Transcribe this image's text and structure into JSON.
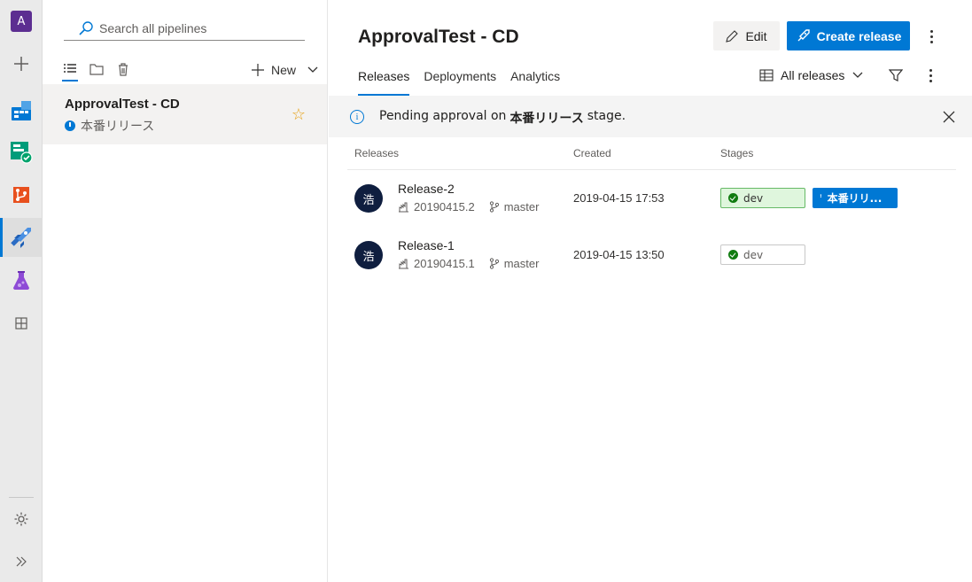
{
  "rail": {
    "org_initial": "A",
    "items": [
      {
        "name": "org-avatar",
        "icon": "org-avatar"
      },
      {
        "name": "new-project",
        "icon": "plus-icon"
      },
      {
        "name": "boards",
        "icon": "boards-icon"
      },
      {
        "name": "test-hub",
        "icon": "repos-check-icon"
      },
      {
        "name": "repos",
        "icon": "repos-icon"
      },
      {
        "name": "pipelines",
        "icon": "pipelines-icon"
      },
      {
        "name": "test-plans",
        "icon": "flask-icon"
      },
      {
        "name": "artifacts",
        "icon": "grid-icon"
      }
    ],
    "settings_icon": "gear-icon",
    "expand_icon": "double-chevron-right-icon"
  },
  "list_panel": {
    "search_placeholder": "Search all pipelines",
    "new_label": "New",
    "pipelines": [
      {
        "name": "ApprovalTest - CD",
        "status": "本番リリース",
        "favorite": true
      }
    ]
  },
  "header": {
    "title": "ApprovalTest - CD",
    "edit_label": "Edit",
    "create_label": "Create release",
    "tabs": [
      {
        "label": "Releases",
        "active": true
      },
      {
        "label": "Deployments",
        "active": false
      },
      {
        "label": "Analytics",
        "active": false
      }
    ],
    "filter_label": "All releases"
  },
  "banner": {
    "prefix": "Pending approval on",
    "stage": "本番リリース",
    "suffix": "stage."
  },
  "table": {
    "columns": [
      "Releases",
      "Created",
      "Stages"
    ],
    "rows": [
      {
        "avatar": "浩",
        "name": "Release-2",
        "build": "20190415.2",
        "branch": "master",
        "created": "2019-04-15 17:53",
        "stages": [
          {
            "label": "dev",
            "state": "succeeded"
          },
          {
            "label": "本番リリ...",
            "state": "pending"
          }
        ]
      },
      {
        "avatar": "浩",
        "name": "Release-1",
        "build": "20190415.1",
        "branch": "master",
        "created": "2019-04-15 13:50",
        "stages": [
          {
            "label": "dev",
            "state": "succeeded-old"
          }
        ]
      }
    ]
  },
  "colors": {
    "accent": "#0078d4",
    "success": "#107c10",
    "avatar_bg": "#0f1e3f",
    "org_avatar": "#5c2e91",
    "star": "#e6a117"
  }
}
